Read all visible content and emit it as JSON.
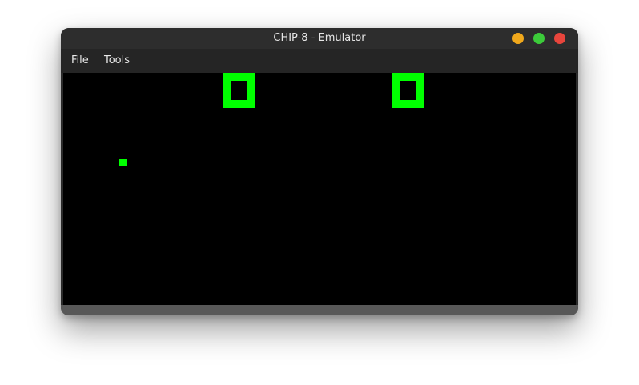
{
  "window": {
    "title": "CHIP-8 - Emulator",
    "buttons": {
      "minimize_color": "#f0a81c",
      "maximize_color": "#3ccb3a",
      "close_color": "#e8453c"
    }
  },
  "menu": {
    "items": [
      {
        "label": "File"
      },
      {
        "label": "Tools"
      }
    ]
  },
  "screen": {
    "background": "#000000",
    "pixel_color": "#00ff00"
  }
}
